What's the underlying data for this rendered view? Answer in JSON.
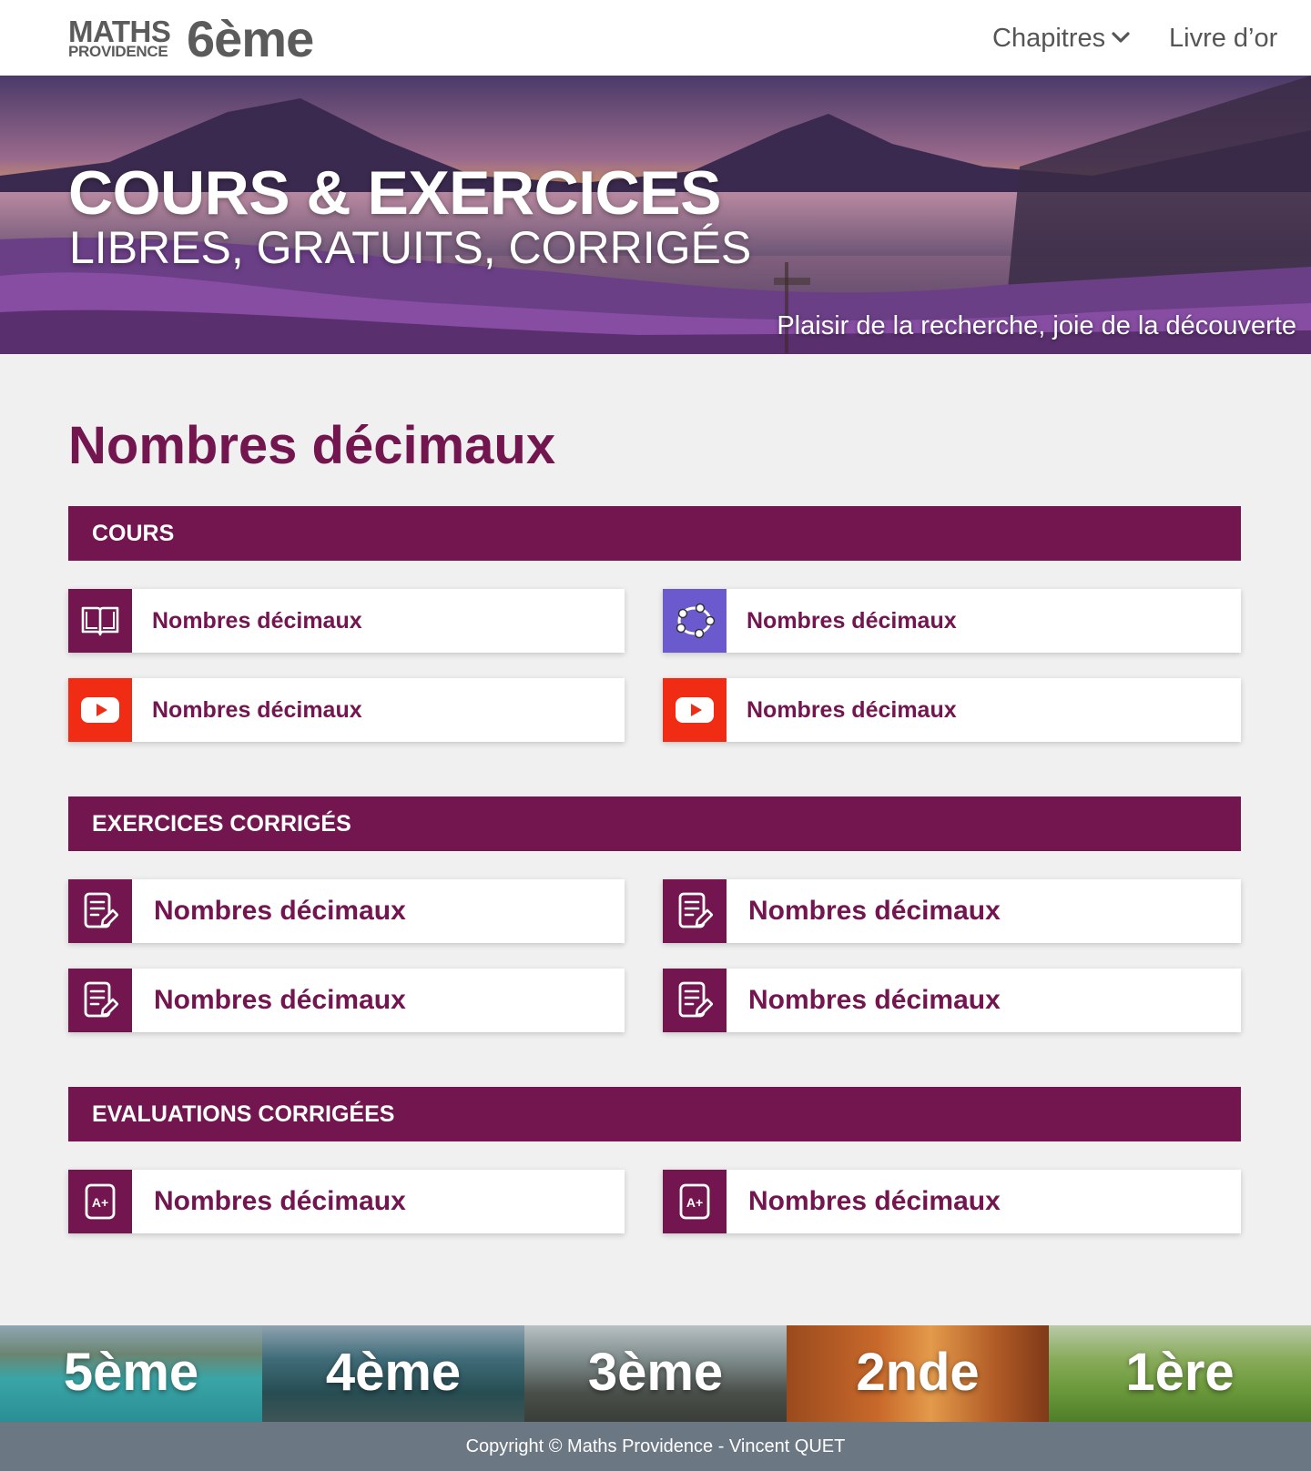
{
  "header": {
    "logo_maths": "MATHS",
    "logo_providence": "PROVIDENCE",
    "logo_level": "6ème",
    "nav_chapitres": "Chapitres",
    "nav_livre": "Livre d’or"
  },
  "hero": {
    "title": "COURS & EXERCICES",
    "subtitle": "LIBRES, GRATUITS, CORRIGÉS",
    "motto": "Plaisir de la recherche, joie de la découverte"
  },
  "main": {
    "page_title": "Nombres décimaux",
    "sections": [
      {
        "heading": "COURS",
        "cards": [
          {
            "label": "Nombres décimaux",
            "icon": "book-icon"
          },
          {
            "label": "Nombres décimaux",
            "icon": "geogebra-icon"
          },
          {
            "label": "Nombres décimaux",
            "icon": "youtube-icon"
          },
          {
            "label": "Nombres décimaux",
            "icon": "youtube-icon"
          }
        ]
      },
      {
        "heading": "EXERCICES CORRIGÉS",
        "cards": [
          {
            "label": "Nombres décimaux",
            "icon": "exercise-sheet-icon"
          },
          {
            "label": "Nombres décimaux",
            "icon": "exercise-sheet-icon"
          },
          {
            "label": "Nombres décimaux",
            "icon": "exercise-sheet-icon"
          },
          {
            "label": "Nombres décimaux",
            "icon": "exercise-sheet-icon"
          }
        ]
      },
      {
        "heading": "EVALUATIONS CORRIGÉES",
        "cards": [
          {
            "label": "Nombres décimaux",
            "icon": "grade-a-plus-icon"
          },
          {
            "label": "Nombres décimaux",
            "icon": "grade-a-plus-icon"
          }
        ]
      }
    ]
  },
  "levels": [
    "5ème",
    "4ème",
    "3ème",
    "2nde",
    "1ère"
  ],
  "footer": {
    "copyright": "Copyright © Maths Providence - Vincent QUET"
  },
  "colors": {
    "brand": "#731650",
    "youtube": "#f02c14",
    "geogebra": "#6a5acd",
    "footer": "#6c7784"
  }
}
